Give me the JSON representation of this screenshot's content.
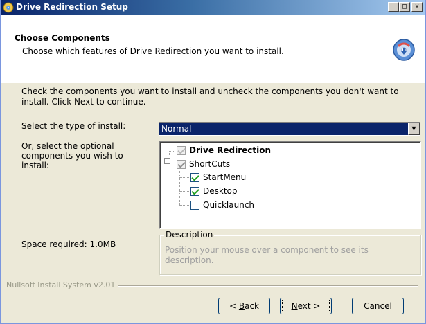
{
  "window": {
    "title": "Drive Redirection Setup",
    "controls": {
      "minimize": "_",
      "maximize": "□",
      "close": "x"
    }
  },
  "header": {
    "title": "Choose Components",
    "subtitle": "Choose which features of Drive Redirection you want to install."
  },
  "body": {
    "instructions": "Check the components you want to install and uncheck the components you don't want to install. Click Next to continue.",
    "install_type_label": "Select the type of install:",
    "install_type_value": "Normal",
    "optional_label": "Or, select the optional components you wish to install:",
    "space_required": "Space required: 1.0MB"
  },
  "components": [
    {
      "label": "Drive Redirection",
      "state": "checked-disabled",
      "bold": true
    },
    {
      "label": "ShortCuts",
      "state": "partial"
    },
    {
      "label": "StartMenu",
      "state": "checked"
    },
    {
      "label": "Desktop",
      "state": "checked"
    },
    {
      "label": "Quicklaunch",
      "state": "unchecked"
    }
  ],
  "description": {
    "legend": "Description",
    "text": "Position your mouse over a component to see its description."
  },
  "footer": {
    "branding": "Nullsoft Install System v2.01"
  },
  "buttons": {
    "back_prefix": "< ",
    "back_accel": "B",
    "back_rest": "ack",
    "next_accel": "N",
    "next_rest": "ext >",
    "cancel": "Cancel"
  },
  "colors": {
    "titlebar_start": "#0a246a",
    "titlebar_end": "#a6caf0",
    "selection": "#0a246a",
    "dialog_bg": "#ece9d8",
    "check_green": "#21a121"
  },
  "icons": [
    "installer-app-icon",
    "installer-disc-icon"
  ]
}
